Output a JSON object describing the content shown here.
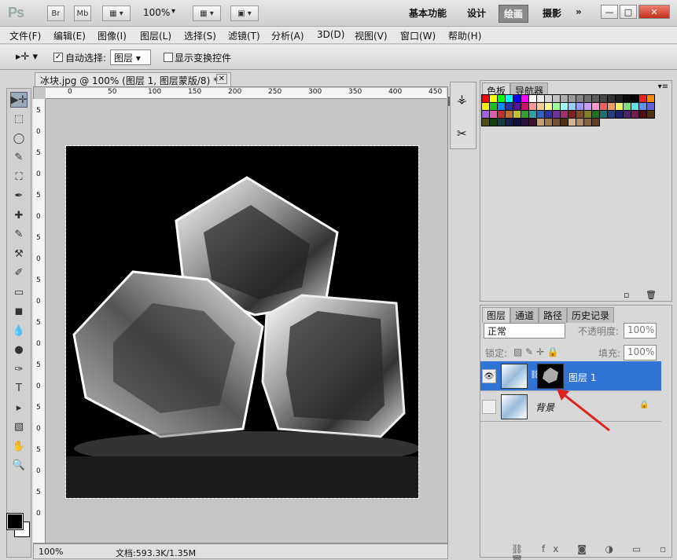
{
  "app": {
    "logo": "Ps",
    "br": "Br",
    "mb": "Mb",
    "zoom": "100%"
  },
  "workspaces": [
    "基本功能",
    "设计",
    "绘画",
    "摄影"
  ],
  "workspace_active": "绘画",
  "workspace_more": "»",
  "window_buttons": {
    "minimize": "—",
    "restore": "□",
    "close": "✕"
  },
  "menu": [
    "文件(F)",
    "编辑(E)",
    "图像(I)",
    "图层(L)",
    "选择(S)",
    "滤镜(T)",
    "分析(A)",
    "3D(D)",
    "视图(V)",
    "窗口(W)",
    "帮助(H)"
  ],
  "options": {
    "auto_select_label": "自动选择:",
    "auto_select_value": "图层",
    "auto_select_checked": "✓",
    "show_transform_label": "显示变换控件"
  },
  "document": {
    "tab_title": "冰块.jpg @ 100% (图层 1, 图层蒙版/8) *",
    "close": "✕"
  },
  "ruler_top": [
    "0",
    "50",
    "100",
    "150",
    "200",
    "250",
    "300",
    "350",
    "400",
    "450"
  ],
  "ruler_left": [
    "5",
    "0",
    "5",
    "0",
    "5",
    "0",
    "5",
    "0",
    "5",
    "0",
    "5",
    "0",
    "5",
    "0",
    "5",
    "0",
    "5",
    "0",
    "5",
    "0"
  ],
  "status": {
    "zoom": "100%",
    "doc": "文档:593.3K/1.35M"
  },
  "swatch_panel": {
    "tabs": [
      "色板",
      "导航器"
    ]
  },
  "swatch_colors": [
    "#ff0000",
    "#ffff00",
    "#00ff00",
    "#00ffff",
    "#0000ff",
    "#ff00ff",
    "#ffffff",
    "#ebebeb",
    "#d6d6d6",
    "#c2c2c2",
    "#adadad",
    "#999999",
    "#858585",
    "#707070",
    "#5c5c5c",
    "#474747",
    "#333333",
    "#1f1f1f",
    "#0a0a0a",
    "#000000",
    "#ee2222",
    "#ff8800",
    "#ffee00",
    "#22bb22",
    "#1188ff",
    "#2233aa",
    "#551199",
    "#cc1166",
    "#ff9999",
    "#ffcc99",
    "#ffff99",
    "#99ff99",
    "#99ffff",
    "#99ccff",
    "#9999ff",
    "#cc99ff",
    "#ff99cc",
    "#f06060",
    "#f0a060",
    "#f0f060",
    "#80e080",
    "#60e0e0",
    "#6090f0",
    "#6060e0",
    "#a060e0",
    "#e060b0",
    "#c03030",
    "#c07030",
    "#c0c030",
    "#30a030",
    "#30a0a0",
    "#3060c0",
    "#3030a0",
    "#7030a0",
    "#a03070",
    "#802020",
    "#805020",
    "#808020",
    "#207020",
    "#207070",
    "#204080",
    "#202070",
    "#502070",
    "#702050",
    "#501010",
    "#503010",
    "#505010",
    "#104010",
    "#104040",
    "#102050",
    "#101040",
    "#301040",
    "#401030",
    "#c8a070",
    "#a07850",
    "#785030",
    "#503010",
    "#d4b48c",
    "#b48c64",
    "#8c643c",
    "#643c1e"
  ],
  "layers_panel": {
    "tabs": [
      "图层",
      "通道",
      "路径",
      "历史记录"
    ],
    "blend_mode": "正常",
    "opacity_label": "不透明度:",
    "opacity": "100%",
    "lock_label": "锁定:",
    "fill_label": "填充:",
    "fill": "100%"
  },
  "layers": [
    {
      "name": "图层 1",
      "visible": "👁",
      "selected": true
    },
    {
      "name": "背景",
      "visible": "",
      "selected": false,
      "lock": "🔒"
    }
  ],
  "tools": [
    "▶✛",
    "⬚",
    "◯",
    "✎",
    "⛶",
    "✒",
    "✚",
    "✎",
    "⚒",
    "✐",
    "▭",
    "◼",
    "💧",
    "●",
    "✑",
    "T",
    "▸",
    "▧",
    "✋",
    "🔍"
  ]
}
